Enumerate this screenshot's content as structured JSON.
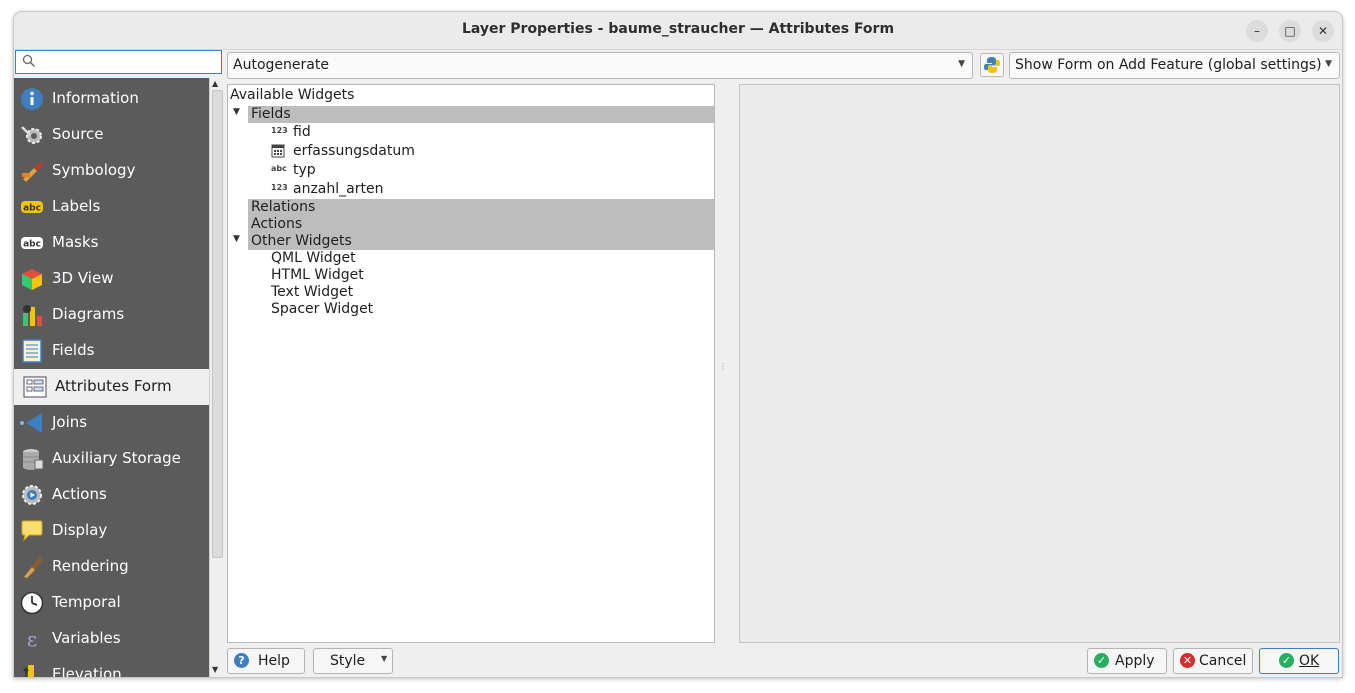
{
  "window": {
    "title": "Layer Properties - baume_straucher — Attributes Form",
    "controls": {
      "minimize": "–",
      "maximize": "□",
      "close": "✕"
    }
  },
  "search": {
    "placeholder": "",
    "icon": "search-icon"
  },
  "sidebar": {
    "items": [
      {
        "label": "Information",
        "icon": "info-icon"
      },
      {
        "label": "Source",
        "icon": "source-gear-icon"
      },
      {
        "label": "Symbology",
        "icon": "paintbrush-icon"
      },
      {
        "label": "Labels",
        "icon": "labels-abc-icon"
      },
      {
        "label": "Masks",
        "icon": "masks-abc-icon"
      },
      {
        "label": "3D View",
        "icon": "cube-icon"
      },
      {
        "label": "Diagrams",
        "icon": "diagrams-icon"
      },
      {
        "label": "Fields",
        "icon": "fields-icon"
      },
      {
        "label": "Attributes Form",
        "icon": "attributes-form-icon",
        "selected": true
      },
      {
        "label": "Joins",
        "icon": "joins-icon"
      },
      {
        "label": "Auxiliary Storage",
        "icon": "database-icon"
      },
      {
        "label": "Actions",
        "icon": "actions-gear-icon"
      },
      {
        "label": "Display",
        "icon": "speech-bubble-icon"
      },
      {
        "label": "Rendering",
        "icon": "brush-icon"
      },
      {
        "label": "Temporal",
        "icon": "clock-icon"
      },
      {
        "label": "Variables",
        "icon": "epsilon-icon"
      },
      {
        "label": "Elevation",
        "icon": "elevation-icon"
      }
    ]
  },
  "toolbar": {
    "layout_combo": "Autogenerate",
    "python_button_icon": "python-icon",
    "show_form_combo": "Show Form on Add Feature (global settings)"
  },
  "tree": {
    "header": "Available Widgets",
    "fields_group": "Fields",
    "fields": [
      {
        "type": "123",
        "name": "fid"
      },
      {
        "type": "date",
        "name": "erfassungsdatum"
      },
      {
        "type": "abc",
        "name": "typ"
      },
      {
        "type": "123",
        "name": "anzahl_arten"
      }
    ],
    "relations_group": "Relations",
    "actions_group": "Actions",
    "other_group": "Other Widgets",
    "other_widgets": [
      "QML Widget",
      "HTML Widget",
      "Text Widget",
      "Spacer Widget"
    ]
  },
  "buttons": {
    "help": "Help",
    "style": "Style",
    "apply": "Apply",
    "cancel": "Cancel",
    "ok": "OK"
  }
}
